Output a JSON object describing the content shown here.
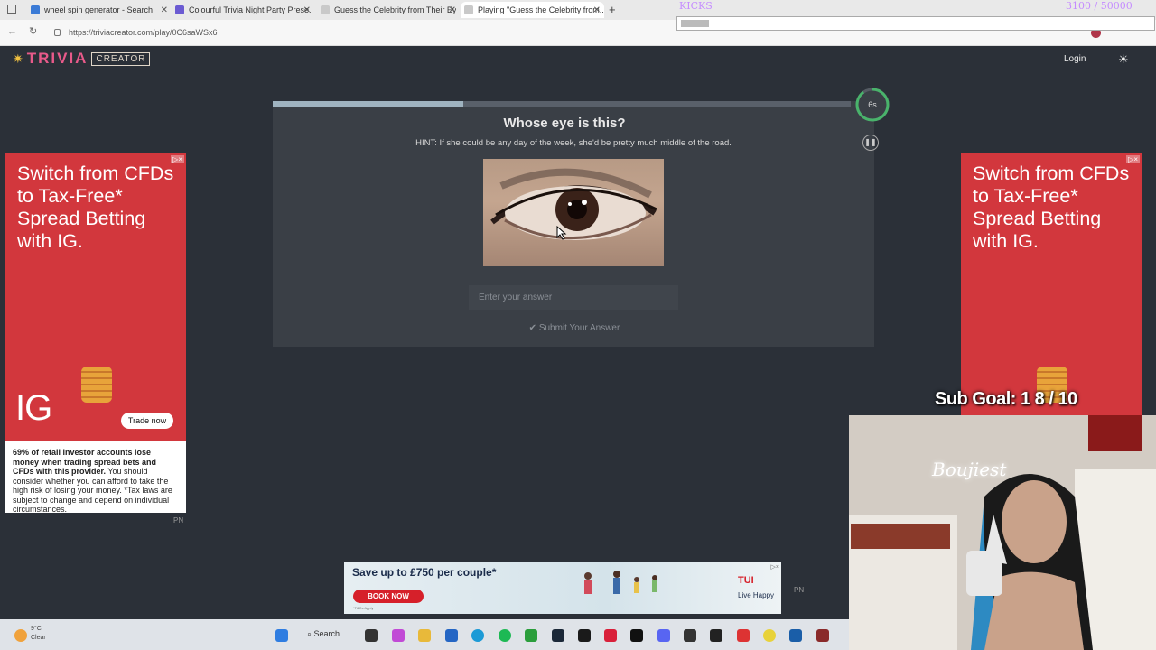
{
  "browser": {
    "tabs": [
      {
        "label": "wheel spin generator - Search",
        "color": "#3b7bd6"
      },
      {
        "label": "Colourful Trivia Night Party Prese...",
        "color": "#6b5bd2"
      },
      {
        "label": "Guess the Celebrity from Their Ey...",
        "color": "#c9c9c9"
      },
      {
        "label": "Playing \"Guess the Celebrity from...",
        "color": "#c9c9c9"
      }
    ],
    "new_tab_label": "+",
    "close_label": "✕",
    "url": "https://triviacreator.com/play/0C6saWSx6"
  },
  "stream_overlay": {
    "kicks_label": "KICKS",
    "kicks_count": "3100 / 50000",
    "kicks_progress": 0.06,
    "sub_goal": "Sub Goal: 1  8 / 10",
    "neon_sign": "Boujiest"
  },
  "site": {
    "logo_trivia": "TRIVIA",
    "logo_creator": "CREATOR",
    "login_label": "Login",
    "theme_icon": "sun-icon"
  },
  "quiz": {
    "progress": 0.33,
    "question": "Whose eye is this?",
    "hint": "HINT: If she could be any day of the week, she'd be pretty much middle of the road.",
    "answer_placeholder": "Enter your answer",
    "submit_label": "Submit Your Answer",
    "timer_label": "6s",
    "timer_fraction": 0.9,
    "pause_icon": "pause-icon"
  },
  "ads": {
    "side_headline": "Switch from CFDs to Tax-Free* Spread Betting with IG.",
    "side_logo": "IG",
    "side_cta": "Trade now",
    "side_adchoice": "▷×",
    "disclaimer_bold": "69% of retail investor accounts lose money when trading spread bets and CFDs with this provider.",
    "disclaimer_rest": " You should consider whether you can afford to take the high risk of losing your money. *Tax laws are subject to change and depend on individual circumstances.",
    "pn_label": "PN",
    "bottom_title": "Save up to £750 per couple*",
    "bottom_cta": "BOOK NOW",
    "bottom_brand": "TUI",
    "bottom_tagline": "Live Happy",
    "bottom_fine": "*T&Cs Apply"
  },
  "taskbar": {
    "weather_temp": "9°C",
    "weather_desc": "Clear",
    "search_label": "Search"
  }
}
